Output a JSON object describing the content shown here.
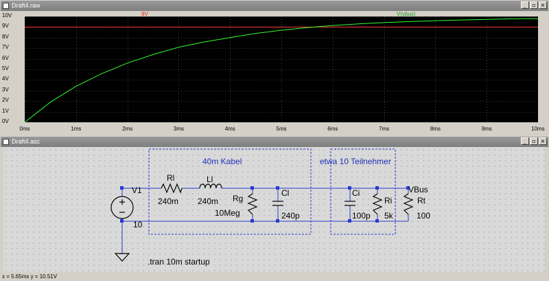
{
  "waveform_window": {
    "title": "Draft4.raw",
    "trace_labels": [
      {
        "text": "9V",
        "color": "#ff3b3b"
      },
      {
        "text": "V(vbus)",
        "color": "#33ff33"
      }
    ],
    "y_ticks": [
      "10V",
      "9V",
      "8V",
      "7V",
      "6V",
      "5V",
      "4V",
      "3V",
      "2V",
      "1V",
      "0V"
    ],
    "x_ticks": [
      "0ms",
      "1ms",
      "2ms",
      "3ms",
      "4ms",
      "5ms",
      "6ms",
      "7ms",
      "8ms",
      "9ms",
      "10ms"
    ]
  },
  "chart_data": {
    "type": "line",
    "x_unit": "ms",
    "y_unit": "V",
    "xlim": [
      0,
      10
    ],
    "ylim": [
      0,
      10
    ],
    "grid": true,
    "series": [
      {
        "name": "9V",
        "color": "#ff3b3b",
        "x": [
          0,
          10
        ],
        "y": [
          9,
          9
        ]
      },
      {
        "name": "V(vbus)",
        "color": "#33ff33",
        "x": [
          0,
          0.5,
          1,
          1.5,
          2,
          2.5,
          3,
          3.5,
          4,
          4.5,
          5,
          5.5,
          6,
          6.5,
          7,
          7.5,
          8,
          8.5,
          9,
          9.5,
          10
        ],
        "y": [
          0,
          1.9,
          3.4,
          4.6,
          5.6,
          6.4,
          7.1,
          7.6,
          8.0,
          8.4,
          8.7,
          8.95,
          9.15,
          9.3,
          9.42,
          9.52,
          9.6,
          9.67,
          9.73,
          9.78,
          9.8
        ]
      }
    ]
  },
  "schematic_window": {
    "title": "Draft4.asc",
    "labels": {
      "cable_box": "40m Kabel",
      "participants_box": "etwa 10 Teilnehmer",
      "source_name": "V1",
      "source_value": "10",
      "rl_name": "Rl",
      "rl_value": "240m",
      "ll_name": "Ll",
      "ll_value": "240m",
      "rg_name": "Rg",
      "rg_value": "10Meg",
      "cl_name": "Cl",
      "cl_value": "240p",
      "ci_name": "Ci",
      "ci_value": "100p",
      "ri_name": "Ri",
      "ri_value": "5k",
      "net_name": "VBus",
      "rt_name": "Rt",
      "rt_value": "100",
      "directive": ".tran 10m startup"
    }
  },
  "status_bar": {
    "text": "x = 5.65ms   y = 10.51V"
  }
}
